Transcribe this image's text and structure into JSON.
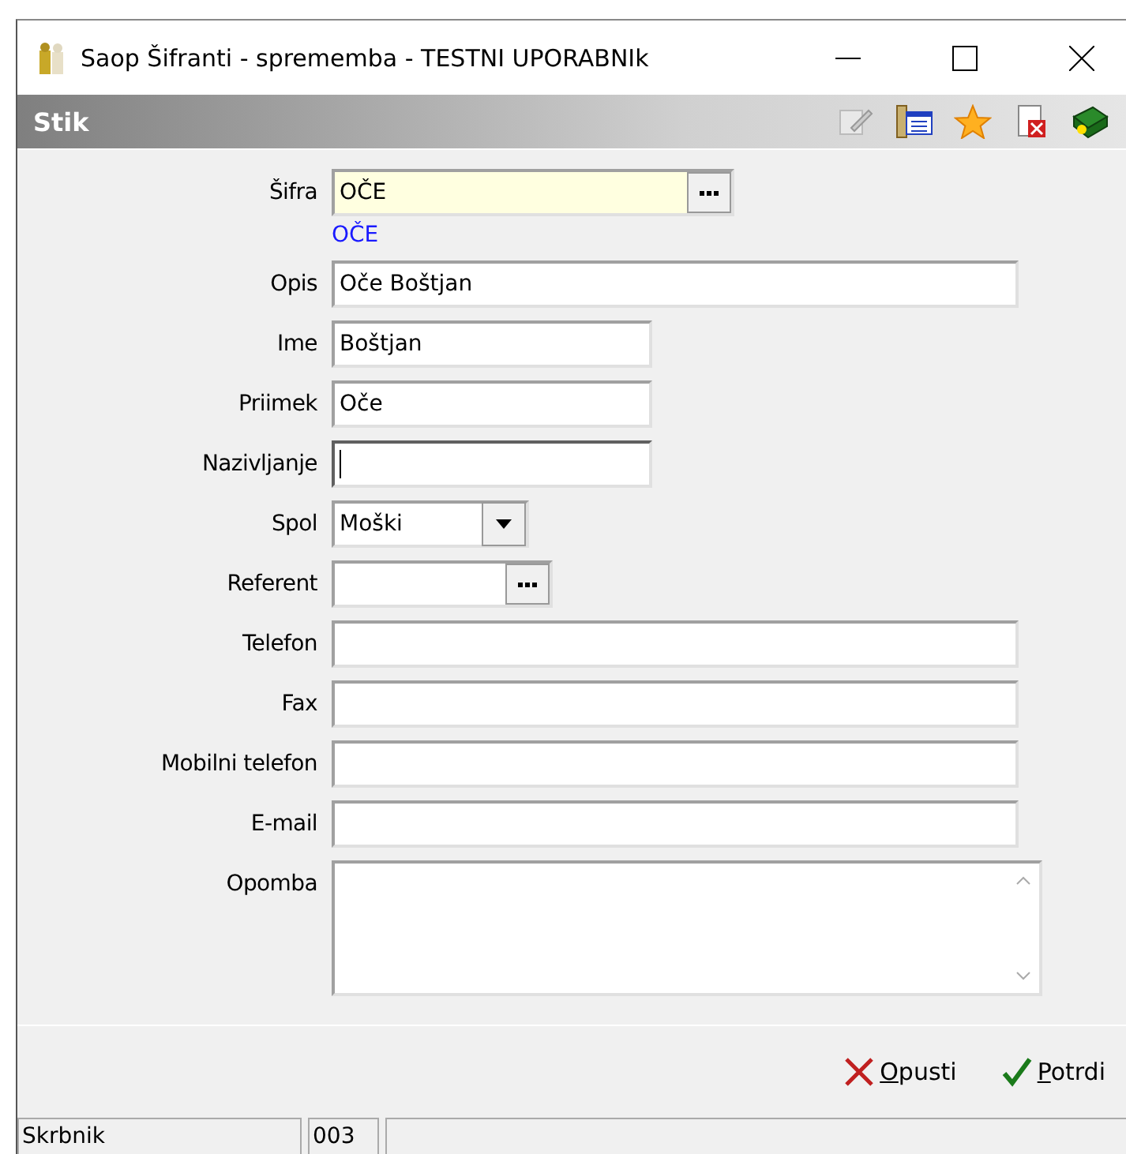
{
  "window": {
    "title": "Saop Šifranti - sprememba - TESTNI UPORABNIk"
  },
  "header": {
    "title": "Stik"
  },
  "fields": [
    {
      "label": "Šifra",
      "kind": "lookup",
      "value": "OČE",
      "highlighted": true,
      "hint": "OČE"
    },
    {
      "label": "Opis",
      "kind": "text",
      "value": "Oče Boštjan"
    },
    {
      "label": "Ime",
      "kind": "text",
      "value": "Boštjan"
    },
    {
      "label": "Priimek",
      "kind": "text",
      "value": "Oče"
    },
    {
      "label": "Nazivljanje",
      "kind": "text",
      "focused": true
    },
    {
      "label": "Spol",
      "kind": "combo",
      "value": "Moški"
    },
    {
      "label": "Referent",
      "kind": "lookup"
    },
    {
      "label": "Telefon",
      "kind": "text"
    },
    {
      "label": "Fax",
      "kind": "text"
    },
    {
      "label": "Mobilni telefon",
      "kind": "text"
    },
    {
      "label": "E-mail",
      "kind": "text"
    },
    {
      "label": "Opomba",
      "kind": "memo"
    }
  ],
  "buttons": [
    {
      "kind": "cancel",
      "label": "Opusti"
    },
    {
      "kind": "confirm",
      "label": "Potrdi"
    }
  ],
  "status_bar": [
    "Skrbnik",
    "003"
  ]
}
